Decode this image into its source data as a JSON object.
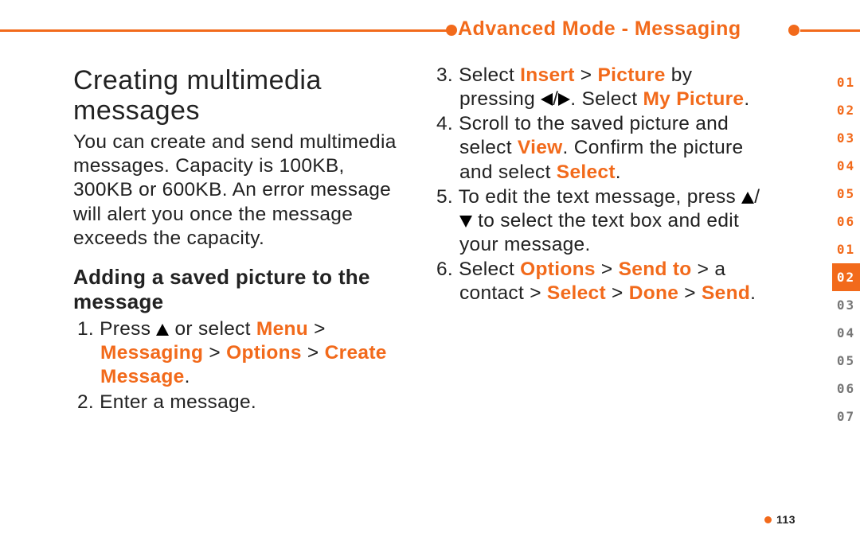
{
  "header": {
    "title": "Advanced Mode - Messaging"
  },
  "page_number": "113",
  "left": {
    "heading": "Creating multimedia messages",
    "intro": "You can create and send multimedia messages. Capacity is 100KB, 300KB or 600KB. An error message will alert you once the message exceeds the capacity.",
    "subheading": "Adding a saved picture to the message",
    "step1": {
      "num": "1.",
      "pre": "Press ",
      "mid": " or select ",
      "menu": "Menu",
      "sep": " > ",
      "messaging": "Messaging",
      "options": "Options",
      "create": "Create Message",
      "end": "."
    },
    "step2": {
      "num": "2.",
      "text": "Enter a message."
    }
  },
  "right": {
    "step3": {
      "num": "3.",
      "pre": "Select ",
      "insert": "Insert",
      "sep": " > ",
      "picture": "Picture",
      "mid": " by pressing ",
      "mid2": ". Select ",
      "mypic": "My Picture",
      "end": "."
    },
    "step4": {
      "num": "4.",
      "pre": "Scroll to the saved picture and select ",
      "view": "View",
      "mid": ". Confirm the picture and select ",
      "select": "Select",
      "end": "."
    },
    "step5": {
      "num": "5.",
      "pre": "To edit the text message, press ",
      "mid": " to select the text box and edit your message."
    },
    "step6": {
      "num": "6.",
      "pre": "Select ",
      "options": "Options",
      "sep": " > ",
      "sendto": "Send to",
      "mid": " > a contact > ",
      "select": "Select",
      "done": "Done",
      "send": "Send",
      "end": "."
    }
  },
  "tabs": {
    "items": [
      "01",
      "02",
      "03",
      "04",
      "05",
      "06",
      "01",
      "02",
      "03",
      "04",
      "05",
      "06",
      "07"
    ],
    "active_index": 7
  }
}
